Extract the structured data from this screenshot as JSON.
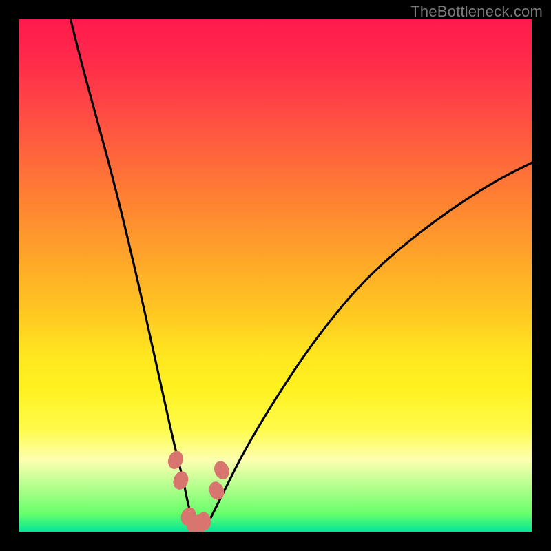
{
  "watermark": "TheBottleneck.com",
  "colors": {
    "frame": "#000000",
    "curve_stroke": "#000000",
    "marker_fill": "#d9756f",
    "marker_stroke": "#d9756f"
  },
  "chart_data": {
    "type": "line",
    "title": "",
    "xlabel": "",
    "ylabel": "",
    "xlim": [
      0,
      100
    ],
    "ylim": [
      0,
      100
    ],
    "note": "Axes are unlabeled; values estimated from pixel positions on a 0-100 normalized scale. y=0 (bottom) is best/green, y=100 (top) is worst/red. Curve is a V-shaped bottleneck curve with minimum near x≈34.",
    "series": [
      {
        "name": "bottleneck-curve",
        "x": [
          10,
          12,
          15,
          18,
          21,
          24,
          26,
          28,
          30,
          32,
          33,
          34,
          35,
          36,
          37,
          38,
          40,
          44,
          50,
          58,
          68,
          80,
          92,
          100
        ],
        "y": [
          100,
          92,
          81,
          70,
          58,
          45,
          36,
          27,
          18,
          10,
          5,
          2,
          1,
          1,
          2,
          4,
          8,
          16,
          26,
          38,
          50,
          60,
          68,
          72
        ]
      }
    ],
    "markers": {
      "name": "highlighted-points",
      "note": "Pink lozenge markers near the trough of the curve",
      "points": [
        {
          "x": 30.5,
          "y": 14
        },
        {
          "x": 31.5,
          "y": 10
        },
        {
          "x": 33.0,
          "y": 3
        },
        {
          "x": 34.0,
          "y": 1.5
        },
        {
          "x": 35.0,
          "y": 1.5
        },
        {
          "x": 36.0,
          "y": 2
        },
        {
          "x": 38.5,
          "y": 8
        },
        {
          "x": 39.5,
          "y": 12
        }
      ]
    }
  }
}
